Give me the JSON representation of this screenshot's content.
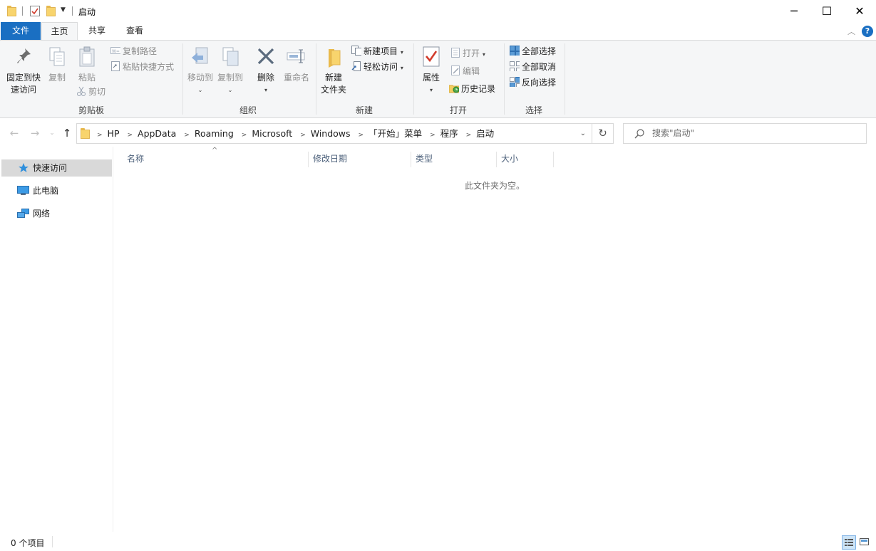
{
  "window": {
    "title": "启动",
    "controls": {
      "minimize": "─",
      "maximize": "☐",
      "close": "✕"
    }
  },
  "ribbon_tabs": [
    {
      "label": "文件"
    },
    {
      "label": "主页"
    },
    {
      "label": "共享"
    },
    {
      "label": "查看"
    }
  ],
  "ribbon": {
    "clipboard": {
      "label": "剪贴板",
      "pin": "固定到快",
      "pin2": "速访问",
      "copy": "复制",
      "paste": "粘贴",
      "copy_path": "复制路径",
      "paste_shortcut": "粘贴快捷方式",
      "cut": "剪切"
    },
    "organize": {
      "label": "组织",
      "move_to": "移动到",
      "copy_to": "复制到",
      "delete": "删除",
      "rename": "重命名"
    },
    "new": {
      "label": "新建",
      "new_folder": "新建",
      "new_folder2": "文件夹",
      "new_item": "新建项目",
      "easy_access": "轻松访问"
    },
    "open": {
      "label": "打开",
      "properties": "属性",
      "open": "打开",
      "edit": "编辑",
      "history": "历史记录"
    },
    "select": {
      "label": "选择",
      "select_all": "全部选择",
      "select_none": "全部取消",
      "invert": "反向选择"
    }
  },
  "address": {
    "breadcrumbs": [
      "HP",
      "AppData",
      "Roaming",
      "Microsoft",
      "Windows",
      "「开始」菜单",
      "程序",
      "启动"
    ],
    "search_placeholder": "搜索\"启动\""
  },
  "nav": {
    "quick_access": "快速访问",
    "this_pc": "此电脑",
    "network": "网络"
  },
  "columns": [
    "名称",
    "修改日期",
    "类型",
    "大小"
  ],
  "empty_message": "此文件夹为空。",
  "status": {
    "item_count": "0 个项目"
  },
  "colors": {
    "accent": "#1a6fc2",
    "selected": "#d9d9d9",
    "folder": "#f8d46d"
  }
}
